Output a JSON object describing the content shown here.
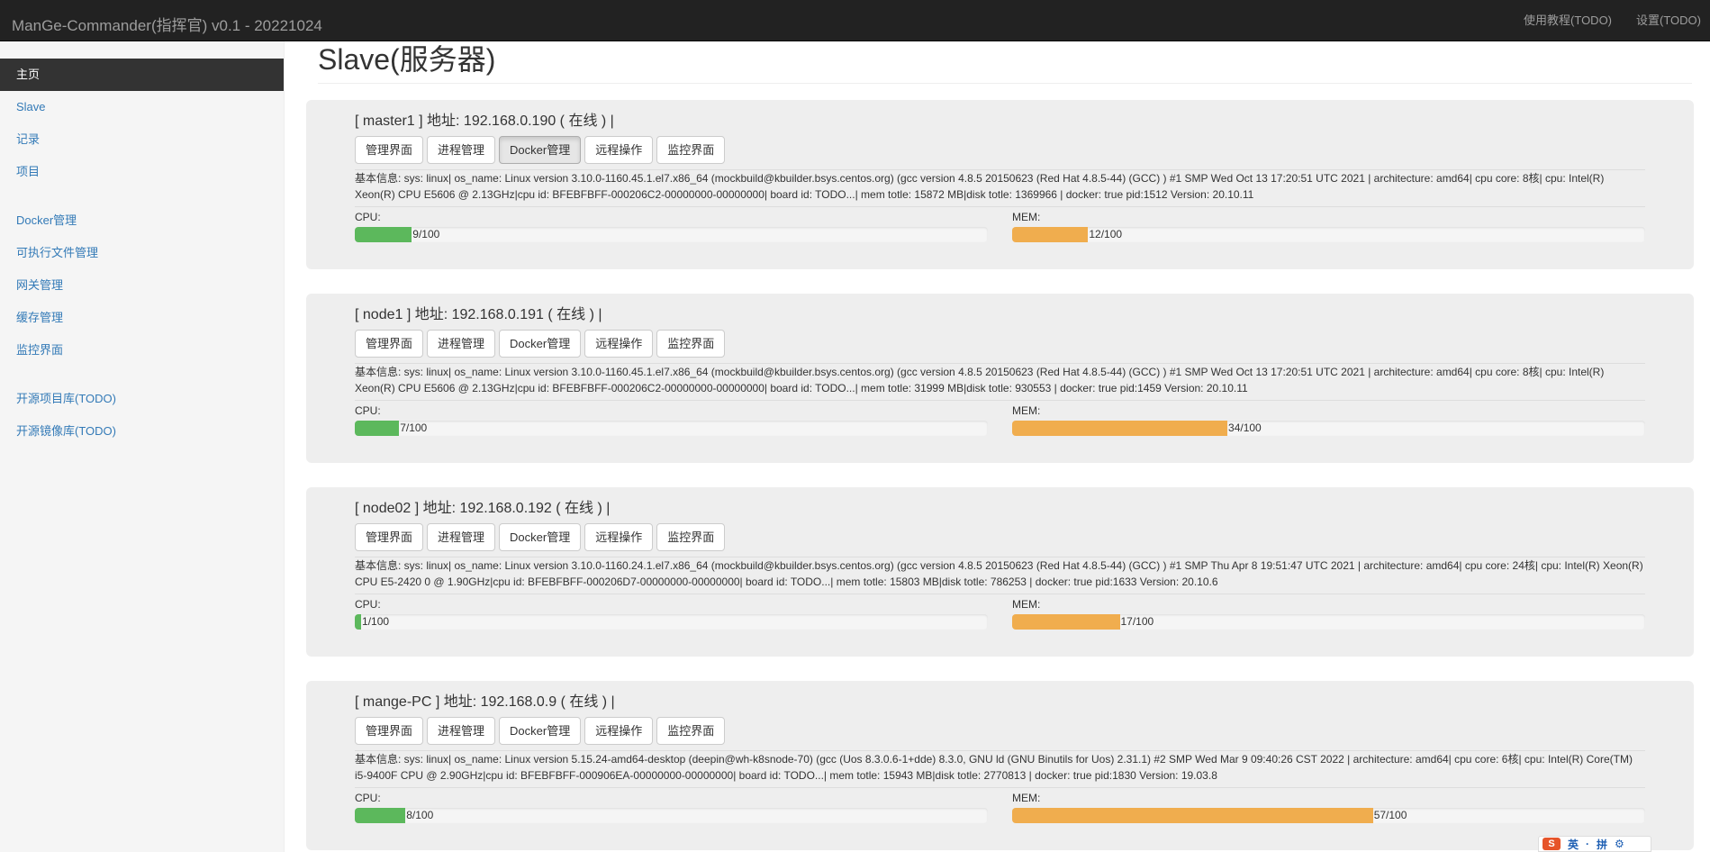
{
  "app": {
    "title": "ManGe-Commander(指挥官) v0.1 - 20221024",
    "top_links": [
      "使用教程(TODO)",
      "设置(TODO)"
    ]
  },
  "sidebar": {
    "groups": [
      [
        {
          "label": "主页",
          "active": true
        },
        {
          "label": "Slave"
        },
        {
          "label": "记录"
        },
        {
          "label": "项目"
        }
      ],
      [
        {
          "label": "Docker管理"
        },
        {
          "label": "可执行文件管理"
        },
        {
          "label": "网关管理"
        },
        {
          "label": "缓存管理"
        },
        {
          "label": "监控界面"
        }
      ],
      [
        {
          "label": "开源项目库(TODO)"
        },
        {
          "label": "开源镜像库(TODO)"
        }
      ]
    ]
  },
  "page": {
    "title": "Slave(服务器)"
  },
  "colors": {
    "cpu_bar": "#5cb85c",
    "mem_bar": "#f0ad4e",
    "active_nav": "#333333"
  },
  "labels": {
    "cpu": "CPU:",
    "mem": "MEM:"
  },
  "buttons": [
    "管理界面",
    "进程管理",
    "Docker管理",
    "远程操作",
    "监控界面"
  ],
  "nodes": [
    {
      "title": "[ master1 ] 地址: 192.168.0.190 ( 在线 ) |",
      "active_button": 2,
      "info": "基本信息: sys: linux| os_name: Linux version 3.10.0-1160.45.1.el7.x86_64 (mockbuild@kbuilder.bsys.centos.org) (gcc version 4.8.5 20150623 (Red Hat 4.8.5-44) (GCC) ) #1 SMP Wed Oct 13 17:20:51 UTC 2021 | architecture: amd64| cpu core: 8核| cpu: Intel(R) Xeon(R) CPU E5606 @ 2.13GHz|cpu id: BFEBFBFF-000206C2-00000000-00000000| board id: TODO...| mem totle: 15872 MB|disk totle: 1369966 | docker: true pid:1512 Version: 20.10.11",
      "cpu": 9,
      "cpu_text": "9/100",
      "mem": 12,
      "mem_text": "12/100"
    },
    {
      "title": "[ node1 ] 地址: 192.168.0.191 ( 在线 ) |",
      "active_button": -1,
      "info": "基本信息: sys: linux| os_name: Linux version 3.10.0-1160.45.1.el7.x86_64 (mockbuild@kbuilder.bsys.centos.org) (gcc version 4.8.5 20150623 (Red Hat 4.8.5-44) (GCC) ) #1 SMP Wed Oct 13 17:20:51 UTC 2021 | architecture: amd64| cpu core: 8核| cpu: Intel(R) Xeon(R) CPU E5606 @ 2.13GHz|cpu id: BFEBFBFF-000206C2-00000000-00000000| board id: TODO...| mem totle: 31999 MB|disk totle: 930553 | docker: true pid:1459 Version: 20.10.11",
      "cpu": 7,
      "cpu_text": "7/100",
      "mem": 34,
      "mem_text": "34/100"
    },
    {
      "title": "[ node02 ] 地址: 192.168.0.192 ( 在线 ) |",
      "active_button": -1,
      "info": "基本信息: sys: linux| os_name: Linux version 3.10.0-1160.24.1.el7.x86_64 (mockbuild@kbuilder.bsys.centos.org) (gcc version 4.8.5 20150623 (Red Hat 4.8.5-44) (GCC) ) #1 SMP Thu Apr 8 19:51:47 UTC 2021 | architecture: amd64| cpu core: 24核| cpu: Intel(R) Xeon(R) CPU E5-2420 0 @ 1.90GHz|cpu id: BFEBFBFF-000206D7-00000000-00000000| board id: TODO...| mem totle: 15803 MB|disk totle: 786253 | docker: true pid:1633 Version: 20.10.6",
      "cpu": 1,
      "cpu_text": "1/100",
      "mem": 17,
      "mem_text": "17/100"
    },
    {
      "title": "[ mange-PC ] 地址: 192.168.0.9 ( 在线 ) |",
      "active_button": -1,
      "info": "基本信息: sys: linux| os_name: Linux version 5.15.24-amd64-desktop (deepin@wh-k8snode-70) (gcc (Uos 8.3.0.6-1+dde) 8.3.0, GNU ld (GNU Binutils for Uos) 2.31.1) #2 SMP Wed Mar 9 09:40:26 CST 2022 | architecture: amd64| cpu core: 6核| cpu: Intel(R) Core(TM) i5-9400F CPU @ 2.90GHz|cpu id: BFEBFBFF-000906EA-00000000-00000000| board id: TODO...| mem totle: 15943 MB|disk totle: 2770813 | docker: true pid:1830 Version: 19.03.8",
      "cpu": 8,
      "cpu_text": "8/100",
      "mem": 57,
      "mem_text": "57/100"
    }
  ],
  "ime": {
    "logo": "S",
    "items": [
      "英",
      "·",
      "拼",
      "⚙"
    ]
  }
}
